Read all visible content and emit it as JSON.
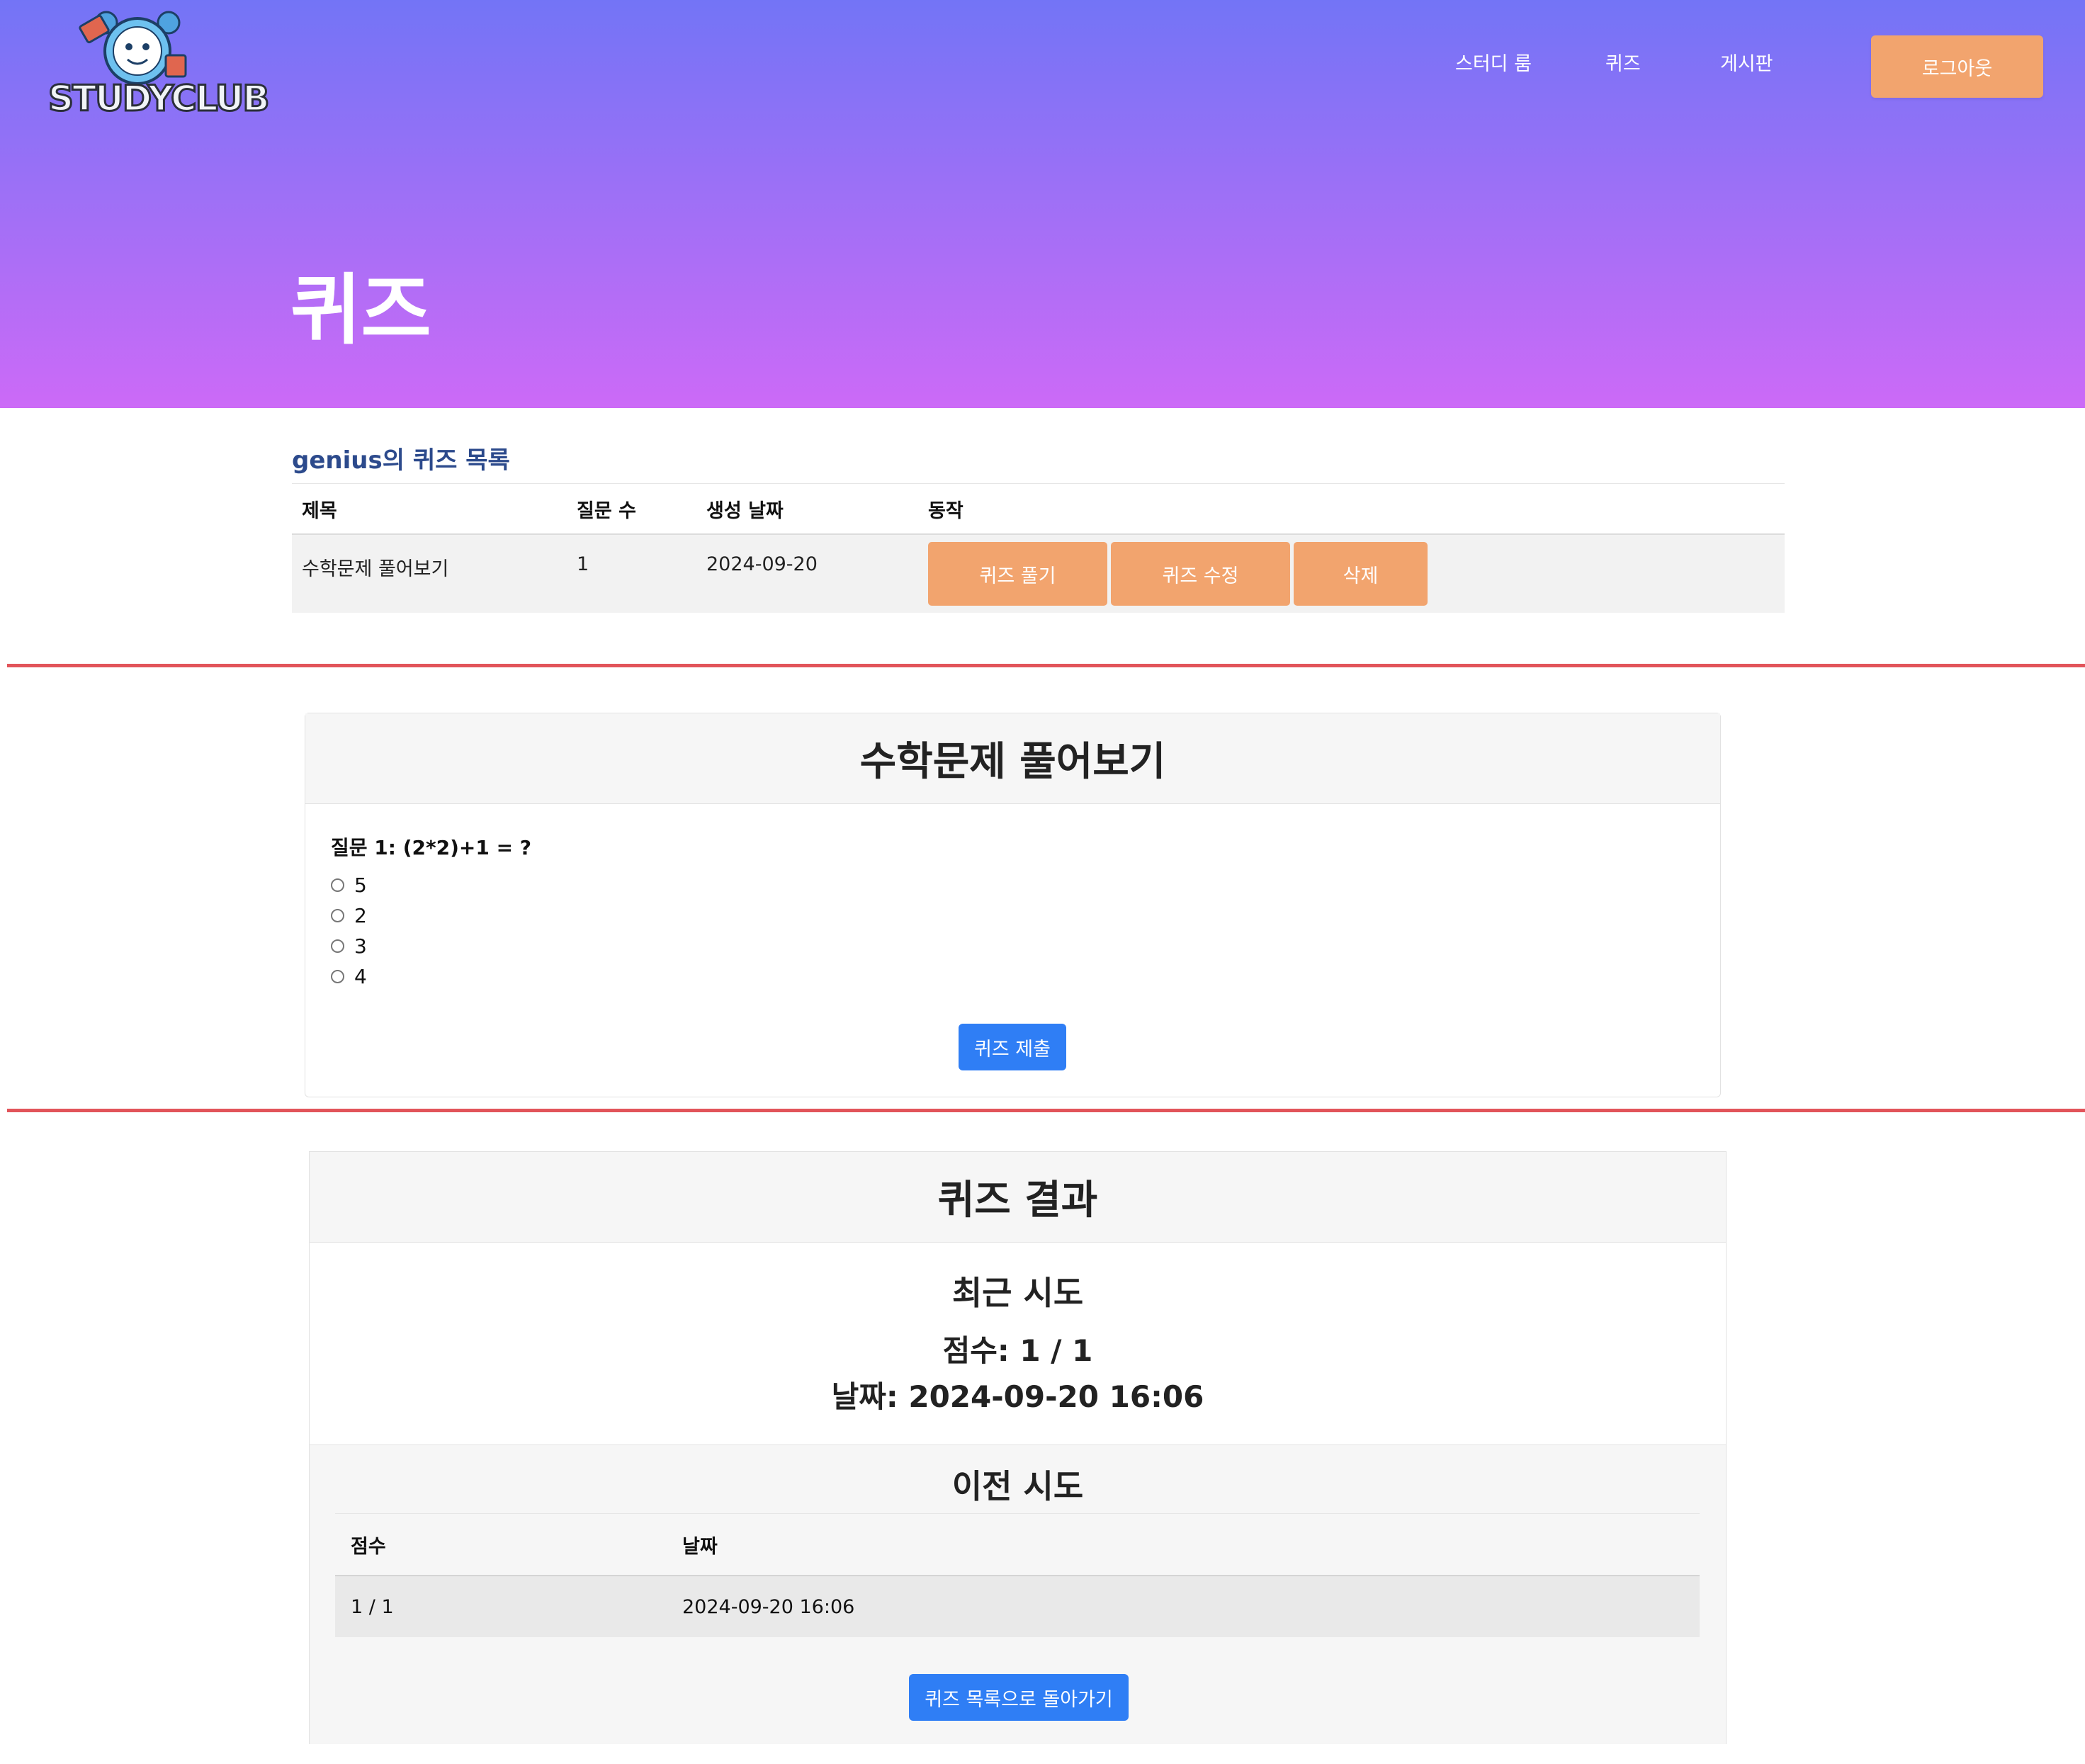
{
  "header": {
    "logo_text": "STUDYCLUB",
    "nav": [
      "스터디 룸",
      "퀴즈",
      "게시판"
    ],
    "logout_label": "로그아웃",
    "page_title": "퀴즈"
  },
  "quiz_list": {
    "heading": "genius의 퀴즈 목록",
    "columns": [
      "제목",
      "질문 수",
      "생성 날짜",
      "동작"
    ],
    "rows": [
      {
        "title": "수학문제 풀어보기",
        "question_count": "1",
        "created": "2024-09-20",
        "actions": [
          "퀴즈 풀기",
          "퀴즈 수정",
          "삭제"
        ]
      }
    ]
  },
  "quiz": {
    "title": "수학문제 풀어보기",
    "question": "질문 1: (2*2)+1 = ?",
    "options": [
      "5",
      "2",
      "3",
      "4"
    ],
    "submit_label": "퀴즈 제출"
  },
  "result": {
    "title": "퀴즈 결과",
    "recent_heading": "최근 시도",
    "score_line": "점수: 1 / 1",
    "date_line": "날짜: 2024-09-20 16:06",
    "previous_heading": "이전 시도",
    "columns": [
      "점수",
      "날짜"
    ],
    "rows": [
      {
        "score": "1 / 1",
        "date": "2024-09-20 16:06"
      }
    ],
    "back_label": "퀴즈 목록으로 돌아가기"
  },
  "colors": {
    "hero_top": "#7374f6",
    "hero_bottom": "#cc6af7",
    "orange_button": "#f2a46e",
    "blue_button": "#2f7ef5",
    "divider_red": "#e2545a"
  }
}
